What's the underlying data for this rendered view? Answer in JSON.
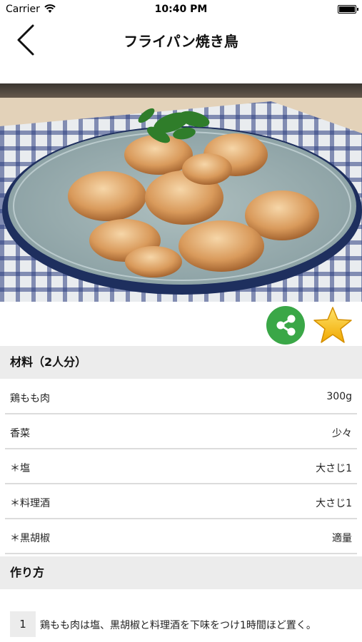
{
  "status_bar": {
    "carrier": "Carrier",
    "time": "10:40 PM"
  },
  "nav": {
    "title": "フライパン焼き鳥"
  },
  "ingredients": {
    "header": "材料（2人分）",
    "items": [
      {
        "name": "鶏もも肉",
        "amount": "300g"
      },
      {
        "name": "香菜",
        "amount": "少々"
      },
      {
        "name": "＊塩",
        "amount": "大さじ1"
      },
      {
        "name": "＊料理酒",
        "amount": "大さじ1"
      },
      {
        "name": "＊黒胡椒",
        "amount": "適量"
      }
    ]
  },
  "steps": {
    "header": "作り方",
    "items": [
      {
        "number": "1",
        "text": "鶏もも肉は塩、黒胡椒と料理酒を下味をつけ1時間ほど置く。"
      }
    ]
  },
  "colors": {
    "share_green": "#3aa747",
    "star_gold": "#f5b800",
    "section_bg": "#ececec"
  }
}
